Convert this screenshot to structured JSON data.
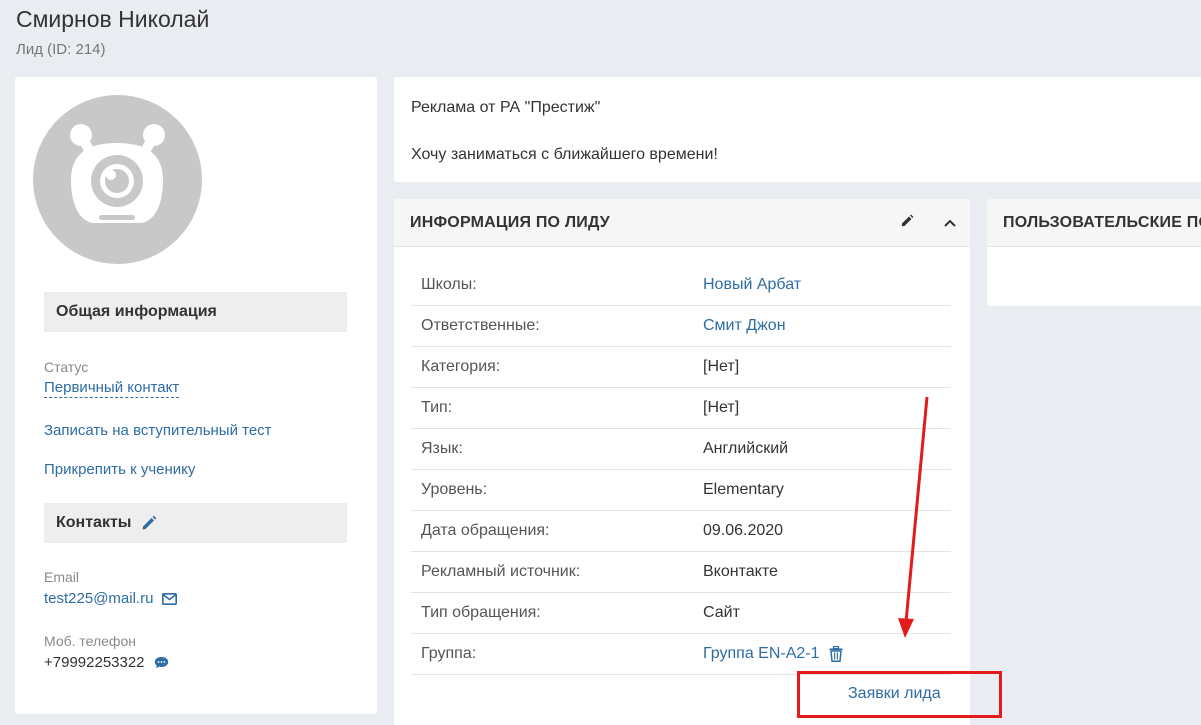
{
  "page": {
    "title": "Смирнов Николай",
    "subtitle": "Лид (ID: 214)"
  },
  "profile": {
    "general_section": "Общая информация",
    "status_label": "Статус",
    "status_value": "Первичный контакт",
    "action_test": "Записать на вступительный тест",
    "action_attach": "Прикрепить к ученику",
    "contacts_section": "Контакты",
    "email_label": "Email",
    "email_value": "test225@mail.ru",
    "phone_label": "Моб. телефон",
    "phone_value": "+79992253322"
  },
  "comment": {
    "line1": "Реклама от РА \"Престиж\"",
    "line2": "Хочу заниматься с ближайшего времени!"
  },
  "lead_info": {
    "title": "ИНФОРМАЦИЯ ПО ЛИДУ",
    "rows": [
      {
        "label": "Школы:",
        "value": "Новый Арбат"
      },
      {
        "label": "Ответственные:",
        "value": "Смит Джон"
      },
      {
        "label": "Категория:",
        "value": "[Нет]"
      },
      {
        "label": "Тип:",
        "value": "[Нет]"
      },
      {
        "label": "Язык:",
        "value": "Английский"
      },
      {
        "label": "Уровень:",
        "value": "Elementary"
      },
      {
        "label": "Дата обращения:",
        "value": "09.06.2020"
      },
      {
        "label": "Рекламный источник:",
        "value": "Вконтакте"
      },
      {
        "label": "Тип обращения:",
        "value": "Сайт"
      },
      {
        "label": "Группа:",
        "value": "Группа EN-A2-1"
      }
    ],
    "requests_link": "Заявки лида"
  },
  "custom_fields": {
    "title": "ПОЛЬЗОВАТЕЛЬСКИЕ ПОЛЯ"
  },
  "colors": {
    "link": "#2e6da4",
    "annotation": "#e31b1b",
    "background": "#e9ecf1"
  }
}
